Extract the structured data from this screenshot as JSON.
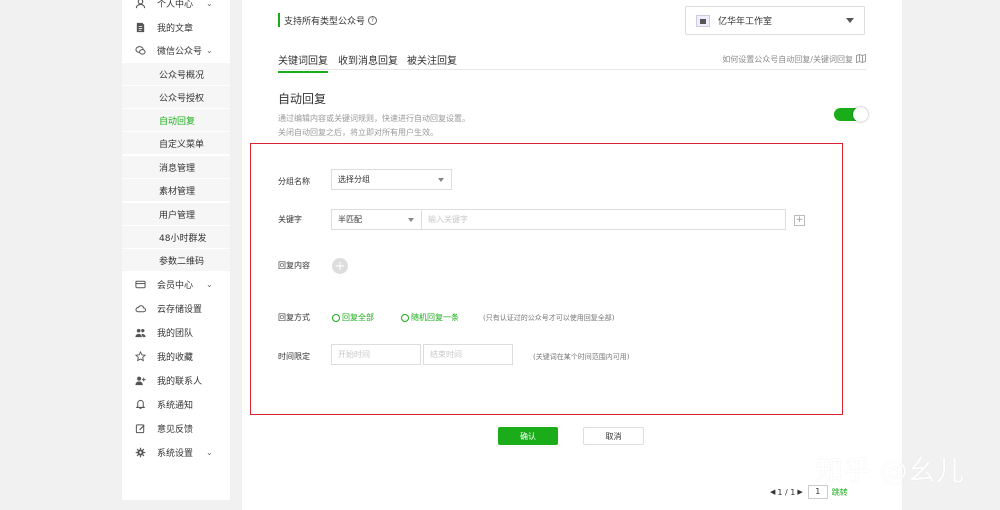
{
  "sidebar": {
    "items": [
      {
        "label": "个人中心",
        "icon": "user-icon",
        "chevron": "⌄"
      },
      {
        "label": "我的文章",
        "icon": "document-icon"
      },
      {
        "label": "微信公众号",
        "icon": "wechat-icon",
        "chevron": "⌄"
      },
      {
        "label": "会员中心",
        "icon": "card-icon",
        "chevron": "⌄"
      },
      {
        "label": "云存储设置",
        "icon": "cloud-icon"
      },
      {
        "label": "我的团队",
        "icon": "team-icon"
      },
      {
        "label": "我的收藏",
        "icon": "star-icon"
      },
      {
        "label": "我的联系人",
        "icon": "add-user-icon"
      },
      {
        "label": "系统通知",
        "icon": "bell-icon"
      },
      {
        "label": "意见反馈",
        "icon": "edit-icon"
      },
      {
        "label": "系统设置",
        "icon": "gear-icon",
        "chevron": "⌄"
      }
    ],
    "submenu": [
      {
        "label": "公众号概况"
      },
      {
        "label": "公众号授权"
      },
      {
        "label": "自动回复",
        "active": true
      },
      {
        "label": "自定义菜单"
      },
      {
        "label": "消息管理"
      },
      {
        "label": "素材管理"
      },
      {
        "label": "用户管理"
      },
      {
        "label": "48小时群发"
      },
      {
        "label": "参数二维码"
      }
    ]
  },
  "header": {
    "support_text": "支持所有类型公众号",
    "help_icon": "?",
    "account_name": "亿华年工作室"
  },
  "tabs": [
    {
      "label": "关键词回复",
      "active": true
    },
    {
      "label": "收到消息回复"
    },
    {
      "label": "被关注回复"
    }
  ],
  "help_link": "如何设置公众号自动回复/关键词回复",
  "section": {
    "title": "自动回复",
    "desc1": "通过编辑内容或关键词规则，快速进行自动回复设置。",
    "desc2": "关闭自动回复之后，将立即对所有用户生效。",
    "toggle_on": true
  },
  "form": {
    "group_label": "分组名称",
    "group_value": "选择分组",
    "keyword_label": "关键字",
    "match_value": "半匹配",
    "keyword_placeholder": "输入关键字",
    "add_symbol": "+",
    "content_label": "回复内容",
    "mode_label": "回复方式",
    "mode_options": [
      "回复全部",
      "随机回复一条"
    ],
    "mode_hint": "(只有认证过的公众号才可以使用回复全部)",
    "time_label": "时间限定",
    "start_placeholder": "开始时间",
    "end_placeholder": "结束时间",
    "time_hint": "(关键词在某个时间范围内可用)"
  },
  "actions": {
    "confirm": "确认",
    "cancel": "取消"
  },
  "pager": {
    "prev": "◀",
    "text": "1 / 1",
    "next": "▶",
    "page": "1",
    "jump": "跳转"
  },
  "watermark": "知乎 @幺儿",
  "colors": {
    "accent": "#1aad19",
    "highlight_border": "#d9232e"
  }
}
